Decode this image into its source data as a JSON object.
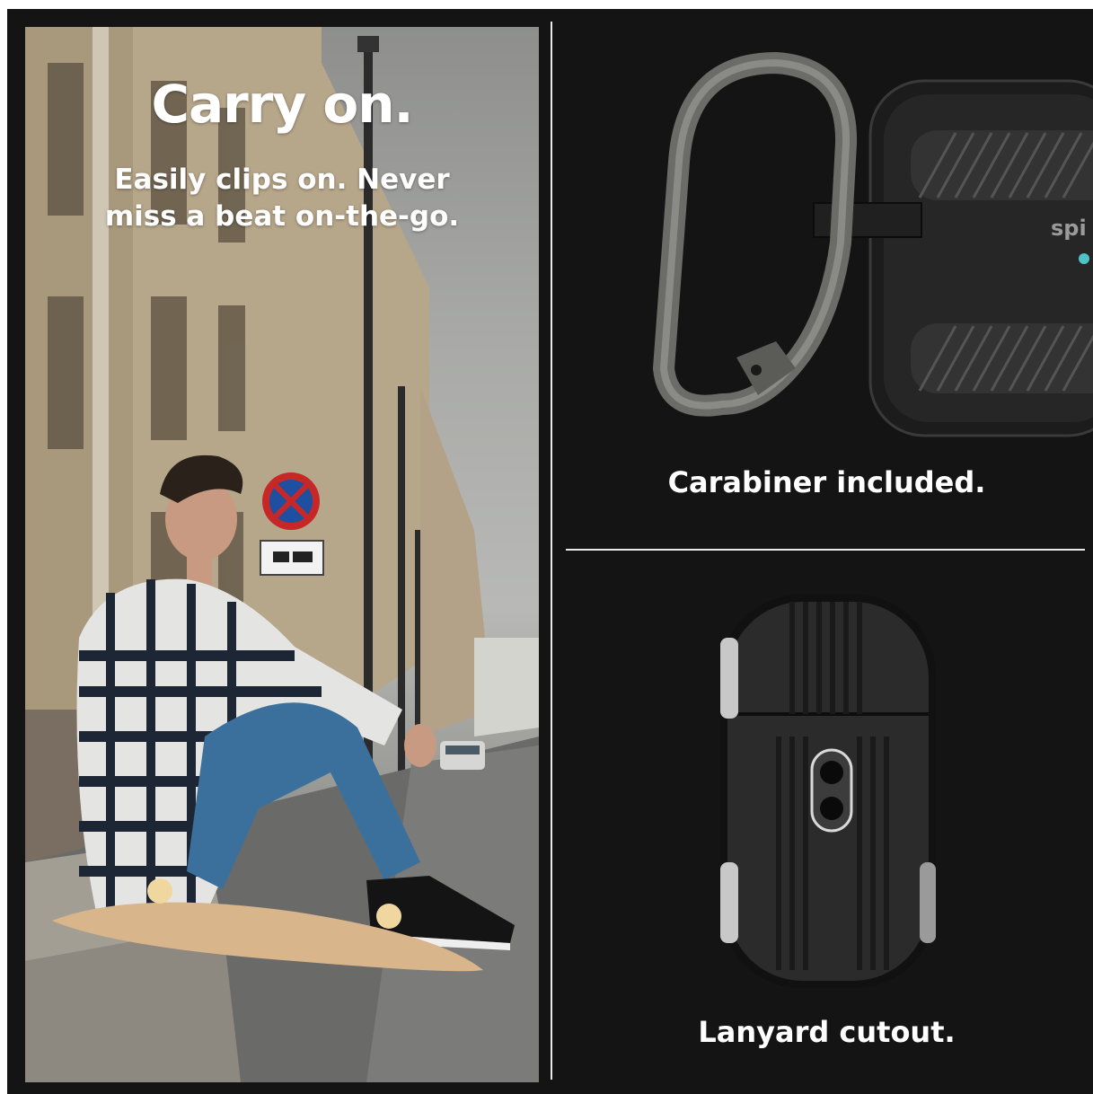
{
  "left_panel": {
    "title": "Carry on.",
    "subtitle_line1": "Easily clips on. Never",
    "subtitle_line2": "miss a beat on-the-go."
  },
  "top_right": {
    "caption": "Carabiner included.",
    "brand_mark": "spi"
  },
  "bottom_right": {
    "caption": "Lanyard cutout."
  },
  "colors": {
    "background": "#141414",
    "divider": "#e8e8e8",
    "text": "#ffffff",
    "case": "#2a2a2a",
    "carabiner": "#6b6b68"
  },
  "icons": [
    "no-parking-sign-icon",
    "tow-away-sign-icon",
    "brand-logo-icon"
  ]
}
